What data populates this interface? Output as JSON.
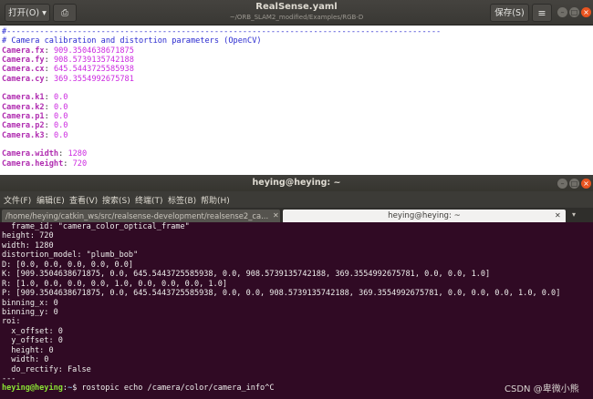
{
  "editor": {
    "open_label": "打开(O)",
    "open_icon": "chevron-down-icon",
    "pin_icon": "pin-icon",
    "title": "RealSense.yaml",
    "subtitle": "~/ORB_SLAM2_modified/Examples/RGB-D",
    "save_label": "保存(S)",
    "menu_icon": "hamburger-menu-icon",
    "code_lines": [
      {
        "type": "hash",
        "text": "#--------------------------------------------------------------------------------------------"
      },
      {
        "type": "comment",
        "text": "# Camera calibration and distortion parameters (OpenCV)"
      },
      {
        "type": "kv",
        "key": "Camera.fx",
        "value": "909.3504638671875"
      },
      {
        "type": "kv",
        "key": "Camera.fy",
        "value": "908.5739135742188"
      },
      {
        "type": "kv",
        "key": "Camera.cx",
        "value": "645.5443725585938"
      },
      {
        "type": "kv",
        "key": "Camera.cy",
        "value": "369.3554992675781"
      },
      {
        "type": "blank",
        "text": ""
      },
      {
        "type": "kv",
        "key": "Camera.k1",
        "value": "0.0"
      },
      {
        "type": "kv",
        "key": "Camera.k2",
        "value": "0.0"
      },
      {
        "type": "kv",
        "key": "Camera.p1",
        "value": "0.0"
      },
      {
        "type": "kv",
        "key": "Camera.p2",
        "value": "0.0"
      },
      {
        "type": "kv",
        "key": "Camera.k3",
        "value": "0.0"
      },
      {
        "type": "blank",
        "text": ""
      },
      {
        "type": "kv",
        "key": "Camera.width",
        "value": "1280"
      },
      {
        "type": "kv",
        "key": "Camera.height",
        "value": "720"
      }
    ]
  },
  "terminal": {
    "title": "heying@heying: ~",
    "menu": [
      "文件(F)",
      "编辑(E)",
      "查看(V)",
      "搜索(S)",
      "终端(T)",
      "标签(B)",
      "帮助(H)"
    ],
    "tabs": [
      {
        "label": "/home/heying/catkin_ws/src/realsense-development/realsense2_ca..."
      },
      {
        "label": "heying@heying: ~"
      }
    ],
    "lines": [
      "  frame_id: \"camera_color_optical_frame\"",
      "height: 720",
      "width: 1280",
      "distortion_model: \"plumb_bob\"",
      "D: [0.0, 0.0, 0.0, 0.0, 0.0]",
      "K: [909.3504638671875, 0.0, 645.5443725585938, 0.0, 908.5739135742188, 369.3554992675781, 0.0, 0.0, 1.0]",
      "R: [1.0, 0.0, 0.0, 0.0, 1.0, 0.0, 0.0, 0.0, 1.0]",
      "P: [909.3504638671875, 0.0, 645.5443725585938, 0.0, 0.0, 908.5739135742188, 369.3554992675781, 0.0, 0.0, 0.0, 1.0, 0.0]",
      "binning_x: 0",
      "binning_y: 0",
      "roi:",
      "  x_offset: 0",
      "  y_offset: 0",
      "  height: 0",
      "  width: 0",
      "  do_rectify: False",
      "---"
    ],
    "prompt": {
      "user": "heying@heying",
      "colon": ":",
      "path": "~",
      "command": "$ rostopic echo /camera/color/camera_info^C"
    }
  },
  "watermark": "CSDN @卑微小熊",
  "colors": {
    "terminal_bg": "#300a24",
    "prompt_user": "#8ae234",
    "prompt_path": "#729fcf",
    "yaml_key": "#b02db0",
    "yaml_value": "#cc2ae0",
    "yaml_comment": "#2a2ad0",
    "close_button": "#e95420"
  }
}
